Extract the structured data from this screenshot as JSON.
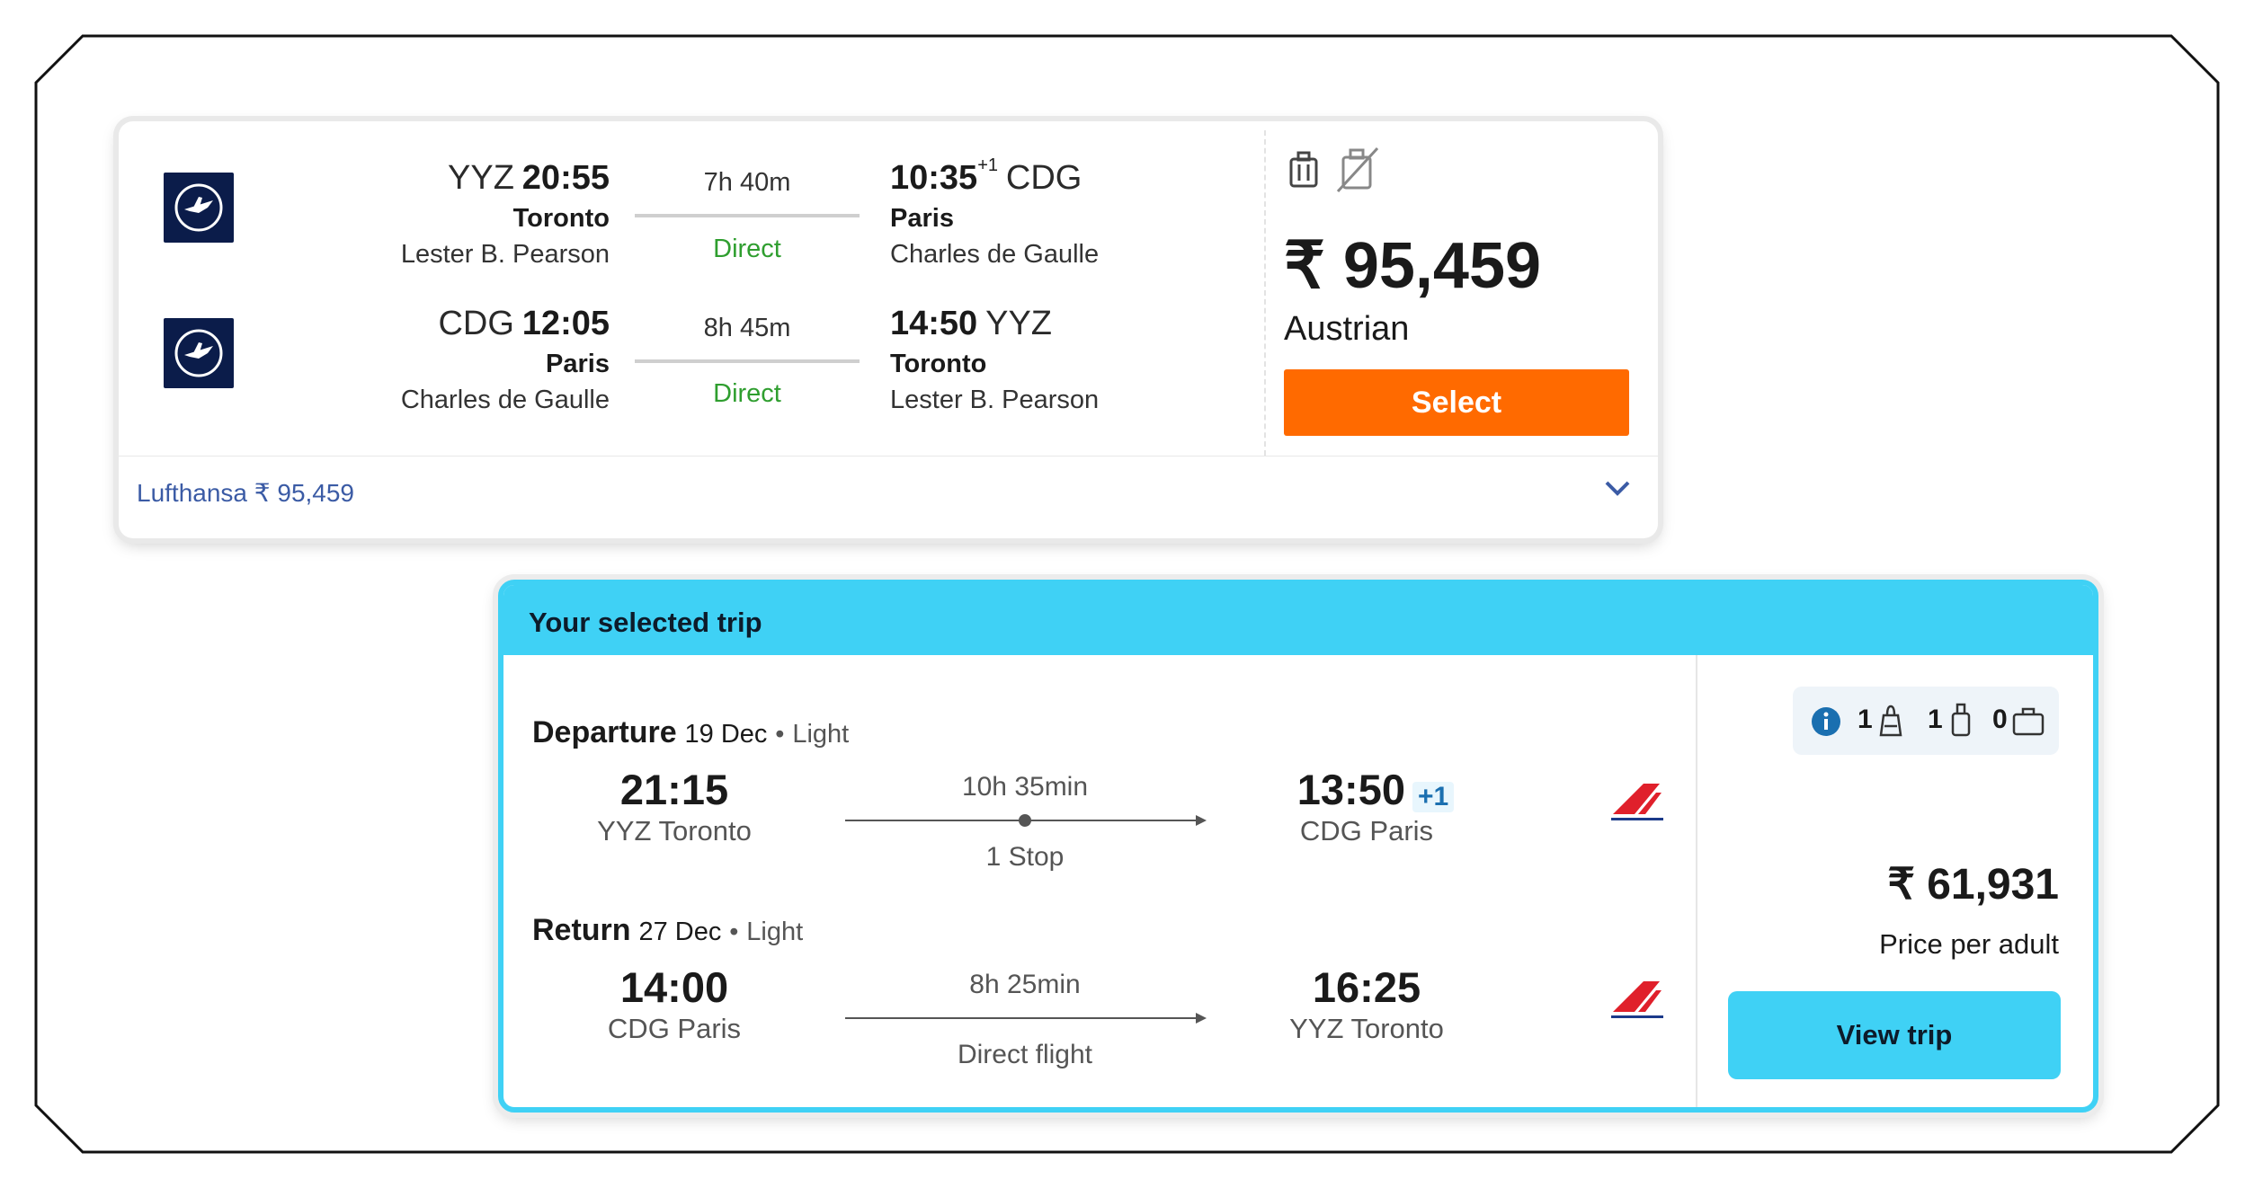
{
  "flight_card": {
    "outbound": {
      "from_code": "YYZ",
      "depart_time": "20:55",
      "from_city": "Toronto",
      "from_airport": "Lester B. Pearson",
      "duration": "7h 40m",
      "stops": "Direct",
      "arrive_time": "10:35",
      "day_offset": "+1",
      "to_code": "CDG",
      "to_city": "Paris",
      "to_airport": "Charles de Gaulle"
    },
    "inbound": {
      "from_code": "CDG",
      "depart_time": "12:05",
      "from_city": "Paris",
      "from_airport": "Charles de Gaulle",
      "duration": "8h 45m",
      "stops": "Direct",
      "arrive_time": "14:50",
      "to_code": "YYZ",
      "to_city": "Toronto",
      "to_airport": "Lester B. Pearson"
    },
    "price": "₹ 95,459",
    "airline": "Austrian",
    "select_label": "Select",
    "footer_label": "Lufthansa ₹ 95,459",
    "icons": [
      "cabin-bag-icon",
      "no-checked-bag-icon",
      "chevron-down-icon",
      "lufthansa-logo"
    ]
  },
  "selected_trip": {
    "title": "Your selected trip",
    "departure": {
      "label": "Departure",
      "date": "19 Dec",
      "fare": "Light",
      "depart_time": "21:15",
      "depart_place": "YYZ Toronto",
      "duration": "10h 35min",
      "stops": "1 Stop",
      "arrive_time": "13:50",
      "day_offset": "+1",
      "arrive_place": "CDG Paris"
    },
    "return": {
      "label": "Return",
      "date": "27 Dec",
      "fare": "Light",
      "depart_time": "14:00",
      "depart_place": "CDG Paris",
      "duration": "8h 25min",
      "stops": "Direct flight",
      "arrive_time": "16:25",
      "arrive_place": "YYZ Toronto"
    },
    "baggage": {
      "personal_item": "1",
      "cabin_bag": "1",
      "checked_bag": "0"
    },
    "price": "₹ 61,931",
    "price_note": "Price per adult",
    "view_label": "View trip",
    "icons": [
      "info-icon",
      "personal-item-icon",
      "cabin-bag-icon",
      "checked-bag-icon",
      "air-france-logo"
    ]
  },
  "colors": {
    "orange": "#ff6a00",
    "cyan": "#3fd1f5",
    "lufthansa_navy": "#0b1c4a",
    "direct_green": "#2f9e2f"
  }
}
